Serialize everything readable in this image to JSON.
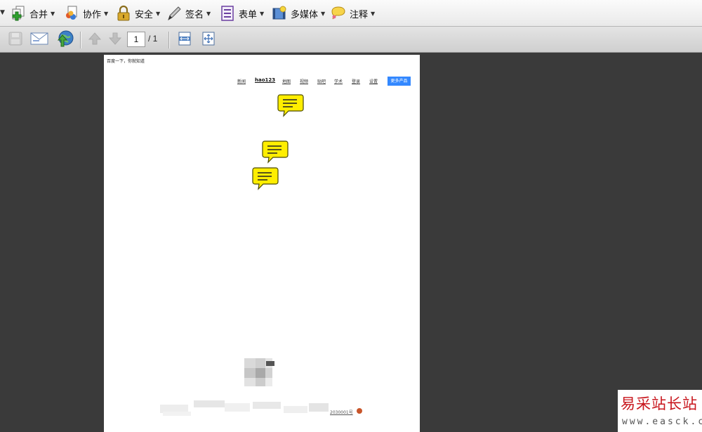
{
  "menu": {
    "items": [
      {
        "label": "合并",
        "icon": "merge-icon"
      },
      {
        "label": "协作",
        "icon": "collaborate-icon"
      },
      {
        "label": "安全",
        "icon": "lock-icon"
      },
      {
        "label": "签名",
        "icon": "pen-icon"
      },
      {
        "label": "表单",
        "icon": "form-icon"
      },
      {
        "label": "多媒体",
        "icon": "multimedia-icon"
      },
      {
        "label": "注释",
        "icon": "comment-icon"
      }
    ]
  },
  "toolbar": {
    "page_current": "1",
    "page_total": "/ 1"
  },
  "document": {
    "page_title": "百度一下，你就知道",
    "nav": [
      "新闻",
      "hao123",
      "地图",
      "视频",
      "贴吧",
      "学术",
      "登录",
      "设置"
    ],
    "more_products": "更多产品",
    "footer_fragment": "2030001号"
  },
  "colors": {
    "accent_blue": "#3388ff",
    "note_yellow": "#ffee00",
    "watermark_red": "#c8161d"
  },
  "watermark": {
    "title": "易采站长站",
    "url": "www.easck.com"
  }
}
